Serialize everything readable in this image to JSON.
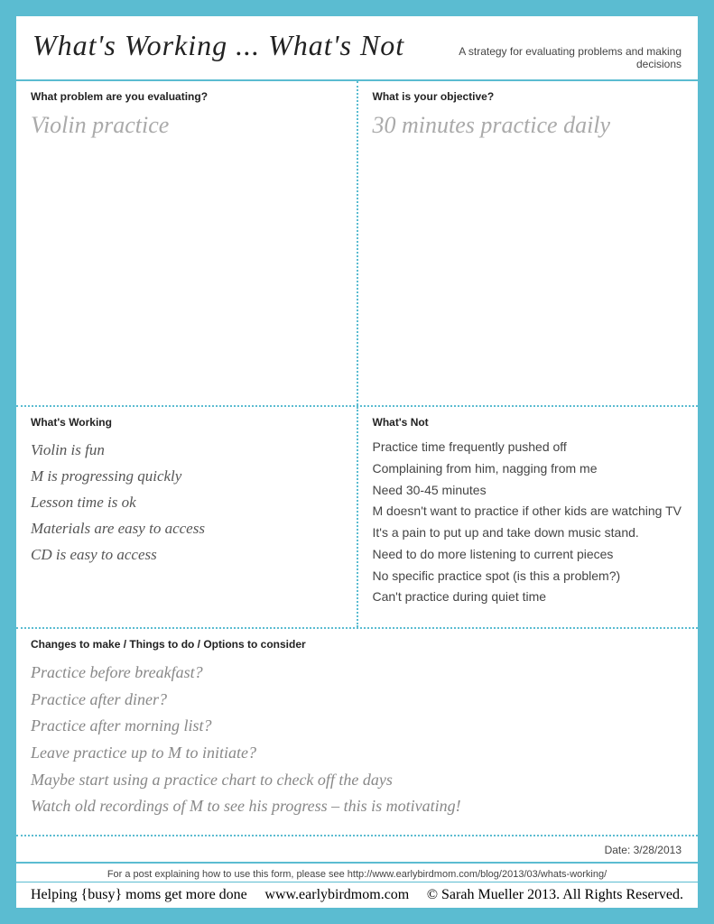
{
  "header": {
    "title": "What's Working ... What's Not",
    "subtitle": "A strategy for evaluating problems and making decisions"
  },
  "problem_section": {
    "label": "What problem are you evaluating?",
    "value": "Violin practice"
  },
  "objective_section": {
    "label": "What is your objective?",
    "value": "30 minutes practice daily"
  },
  "working_section": {
    "label": "What's Working",
    "items": [
      "Violin is fun",
      "M is progressing quickly",
      "Lesson time is ok",
      "Materials are easy to access",
      "CD is easy to access"
    ]
  },
  "not_section": {
    "label": "What's Not",
    "items": [
      "Practice time frequently pushed off",
      "Complaining from him, nagging from me",
      "Need 30-45 minutes",
      "M doesn't want to practice if other kids are watching TV",
      "It's a pain to put up and take down music stand.",
      "Need to do more listening to current pieces",
      "No specific practice spot (is this a problem?)",
      "Can't practice during quiet time"
    ]
  },
  "changes_section": {
    "label": "Changes to make / Things to do / Options to consider",
    "items": [
      "Practice before breakfast?",
      "Practice after diner?",
      "Practice after morning list?",
      "Leave practice up to M to initiate?",
      "Maybe start using a practice chart to check off the days",
      "Watch old recordings of M to see his progress – this is motivating!"
    ]
  },
  "date": "Date: 3/28/2013",
  "footer": {
    "top_row": "For a post explaining how to use this form, please see http://www.earlybirdmom.com/blog/2013/03/whats-working/",
    "bottom_left": "Helping {busy} moms get more done",
    "bottom_center": "www.earlybirdmom.com",
    "bottom_right": "© Sarah Mueller 2013. All Rights Reserved."
  }
}
